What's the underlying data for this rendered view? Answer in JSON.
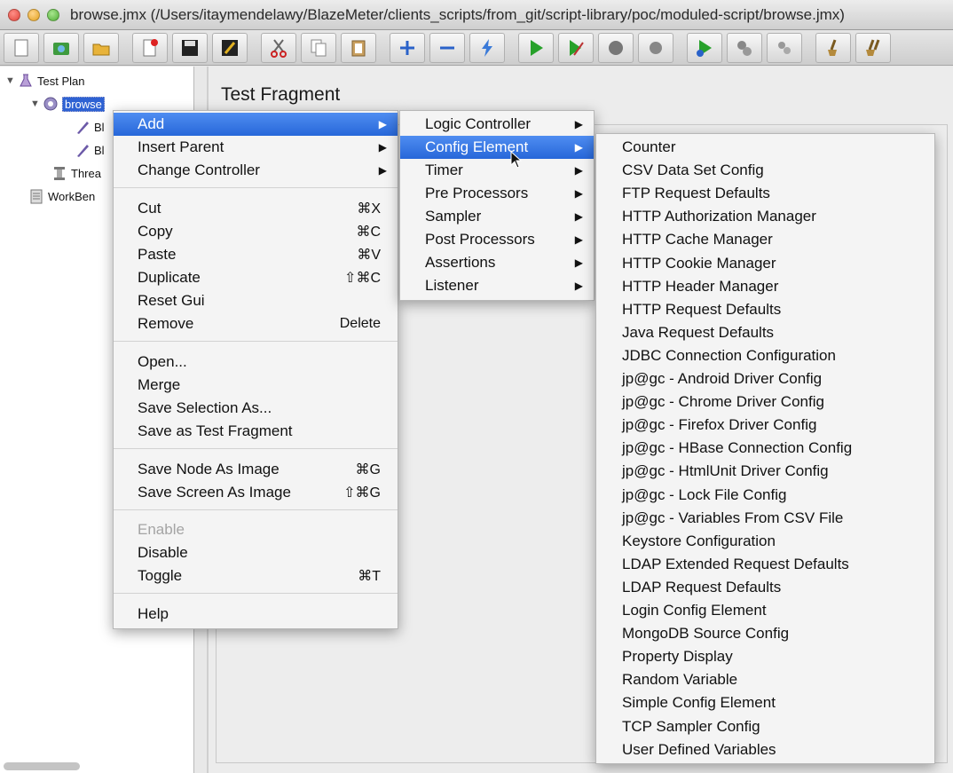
{
  "window": {
    "title": "browse.jmx (/Users/itaymendelawy/BlazeMeter/clients_scripts/from_git/script-library/poc/moduled-script/browse.jmx)"
  },
  "toolbar": {
    "buttons": [
      "new-icon",
      "templates-icon",
      "open-icon",
      "close-icon",
      "save-icon",
      "save-as-icon",
      "cut-icon",
      "copy-icon",
      "paste-icon",
      "expand-icon",
      "collapse-icon",
      "toggle-icon",
      "start-icon",
      "start-no-pause-icon",
      "stop-icon",
      "shutdown-icon",
      "remote-start-icon",
      "remote-stop-icon",
      "remote-shutdown-icon",
      "clear-icon",
      "clear-all-icon"
    ]
  },
  "tree": {
    "test_plan": "Test Plan",
    "browse": "browse",
    "child1": "Bl",
    "child2": "Bl",
    "thread": "Threa",
    "workbench": "WorkBen"
  },
  "panel": {
    "title": "Test Fragment"
  },
  "context_menu": {
    "add": "Add",
    "insert_parent": "Insert Parent",
    "change_controller": "Change Controller",
    "cut": "Cut",
    "cut_sc": "⌘X",
    "copy": "Copy",
    "copy_sc": "⌘C",
    "paste": "Paste",
    "paste_sc": "⌘V",
    "duplicate": "Duplicate",
    "duplicate_sc": "⇧⌘C",
    "reset_gui": "Reset Gui",
    "remove": "Remove",
    "remove_sc": "Delete",
    "open": "Open...",
    "merge": "Merge",
    "save_selection": "Save Selection As...",
    "save_fragment": "Save as Test Fragment",
    "save_node_image": "Save Node As Image",
    "save_node_image_sc": "⌘G",
    "save_screen_image": "Save Screen As Image",
    "save_screen_image_sc": "⇧⌘G",
    "enable": "Enable",
    "disable": "Disable",
    "toggle": "Toggle",
    "toggle_sc": "⌘T",
    "help": "Help"
  },
  "add_submenu": {
    "items": [
      "Logic Controller",
      "Config Element",
      "Timer",
      "Pre Processors",
      "Sampler",
      "Post Processors",
      "Assertions",
      "Listener"
    ]
  },
  "config_submenu": {
    "items": [
      "Counter",
      "CSV Data Set Config",
      "FTP Request Defaults",
      "HTTP Authorization Manager",
      "HTTP Cache Manager",
      "HTTP Cookie Manager",
      "HTTP Header Manager",
      "HTTP Request Defaults",
      "Java Request Defaults",
      "JDBC Connection Configuration",
      "jp@gc - Android Driver Config",
      "jp@gc - Chrome Driver Config",
      "jp@gc - Firefox Driver Config",
      "jp@gc - HBase Connection Config",
      "jp@gc - HtmlUnit Driver Config",
      "jp@gc - Lock File Config",
      "jp@gc - Variables From CSV File",
      "Keystore Configuration",
      "LDAP Extended Request Defaults",
      "LDAP Request Defaults",
      "Login Config Element",
      "MongoDB Source Config",
      "Property Display",
      "Random Variable",
      "Simple Config Element",
      "TCP Sampler Config",
      "User Defined Variables"
    ]
  }
}
